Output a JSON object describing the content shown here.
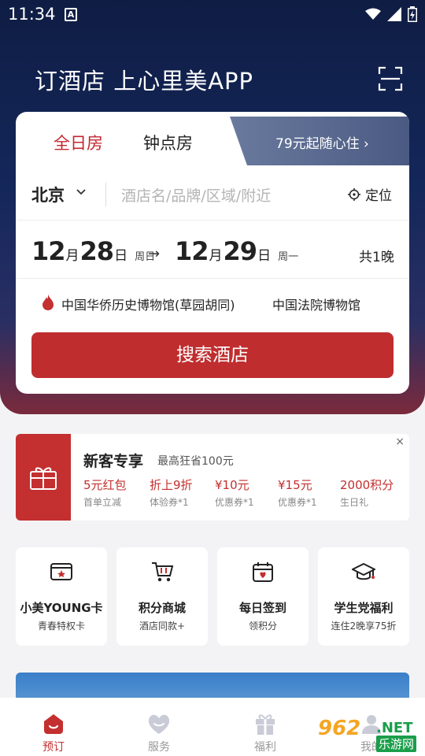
{
  "status": {
    "time": "11:34",
    "a_badge": "A"
  },
  "header": {
    "title": "订酒店 上心里美APP"
  },
  "booking": {
    "tabs": [
      {
        "label": "全日房"
      },
      {
        "label": "钟点房"
      }
    ],
    "promo": "79元起随心住 ›",
    "city": "北京",
    "search_placeholder": "酒店名/品牌/区域/附近",
    "locate_label": "定位",
    "checkin": {
      "month": "12",
      "month_unit": "月",
      "day": "28",
      "day_unit": "日",
      "weekday": "周日"
    },
    "checkout": {
      "month": "12",
      "month_unit": "月",
      "day": "29",
      "day_unit": "日",
      "weekday": "周一"
    },
    "arrow": "→",
    "nights": "共1晚",
    "pois": [
      "中国华侨历史博物馆(草园胡同)",
      "中国法院博物馆"
    ],
    "search_button": "搜索酒店"
  },
  "new_user": {
    "title": "新客专享",
    "subtitle": "最高狂省100元",
    "close": "×",
    "coupons": [
      {
        "value": "5元红包",
        "desc": "首单立减"
      },
      {
        "value": "折上9折",
        "desc": "体验券*1"
      },
      {
        "value": "¥10元",
        "desc": "优惠券*1"
      },
      {
        "value": "¥15元",
        "desc": "优惠券*1"
      },
      {
        "value": "2000积分",
        "desc": "生日礼"
      }
    ]
  },
  "services": [
    {
      "title": "小美YOUNG卡",
      "subtitle": "青春特权卡",
      "icon": "member-card-icon"
    },
    {
      "title": "积分商城",
      "subtitle": "酒店同款+",
      "icon": "cart-icon"
    },
    {
      "title": "每日签到",
      "subtitle": "领积分",
      "icon": "calendar-icon"
    },
    {
      "title": "学生党福利",
      "subtitle": "连住2晚享75折",
      "icon": "graduation-cap-icon"
    }
  ],
  "banner": {
    "text": ""
  },
  "tabbar": [
    {
      "label": "预订",
      "active": true
    },
    {
      "label": "服务",
      "active": false
    },
    {
      "label": "福利",
      "active": false
    },
    {
      "label": "我的",
      "active": false
    }
  ],
  "watermark": {
    "main": "962",
    "net": ".NET",
    "sub": "乐游网"
  },
  "colors": {
    "accent": "#c42f2f",
    "hero_dark": "#0f1d44",
    "inactive_tab": "#999999"
  }
}
